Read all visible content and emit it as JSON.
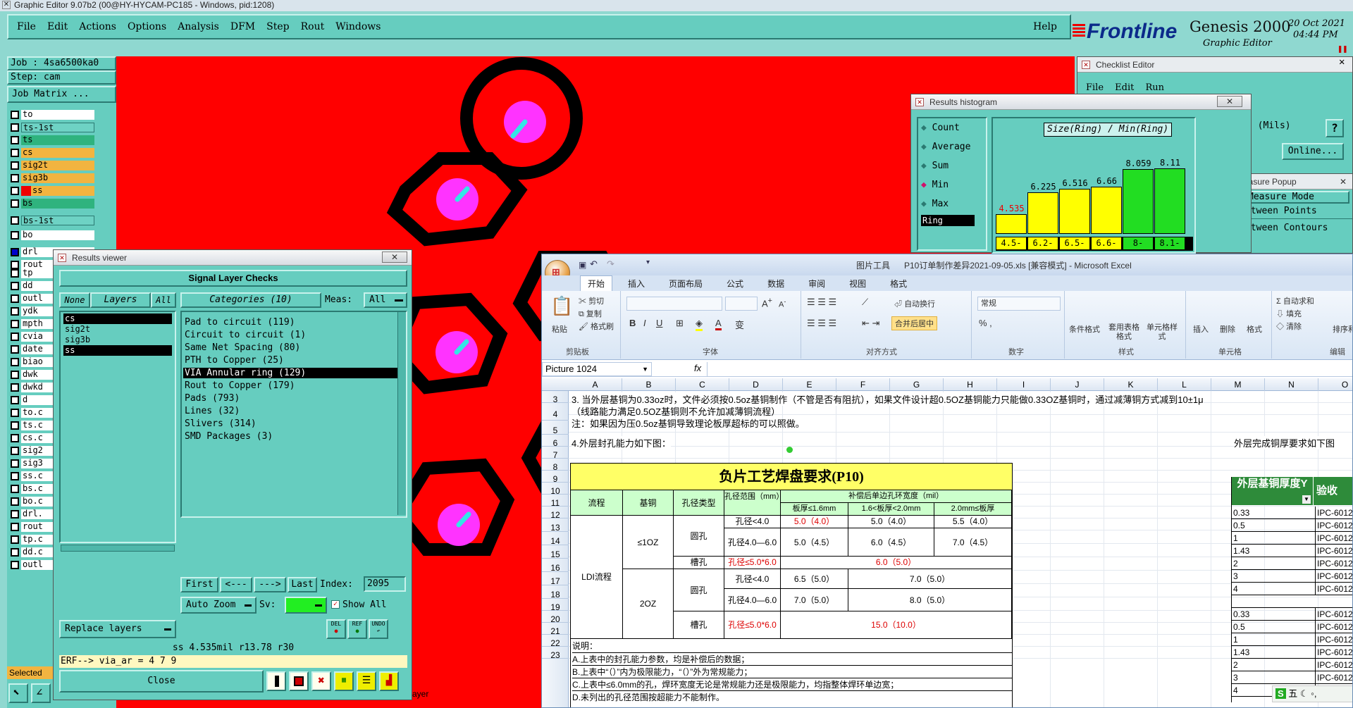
{
  "window_title": "Graphic Editor 9.07b2 (00@HY-HYCAM-PC185 - Windows, pid:1208)",
  "menu": [
    "File",
    "Edit",
    "Actions",
    "Options",
    "Analysis",
    "DFM",
    "Step",
    "Rout",
    "Windows"
  ],
  "help": "Help",
  "brand": {
    "name": "Frontline",
    "product": "Genesis 2000",
    "subtitle": "Graphic Editor",
    "date": "20 Oct 2021",
    "time": "04:44 PM"
  },
  "job": {
    "job_label": "Job : 4sa6500ka0",
    "step_label": "Step: cam",
    "matrix_btn": "Job Matrix ..."
  },
  "layers": [
    {
      "name": "to",
      "bg": "#ffffff"
    },
    {
      "name": "ts-1st",
      "bg": "#6ed2c4"
    },
    {
      "name": "ts",
      "bg": "#2fb37e"
    },
    {
      "name": "cs",
      "bg": "#f2b440"
    },
    {
      "name": "sig2t",
      "bg": "#f2b440"
    },
    {
      "name": "sig3b",
      "bg": "#f2b440"
    },
    {
      "name": "ss",
      "bg": "#f2b440"
    },
    {
      "name": "bs",
      "bg": "#2fb37e"
    },
    {
      "name": "bs-1st",
      "bg": "#6ed2c4"
    },
    {
      "name": "bo",
      "bg": "#ffffff"
    },
    {
      "name": "drl",
      "bg": "#ffffff"
    },
    {
      "name": "rout",
      "bg": "#ffffff"
    }
  ],
  "layers_lower": [
    "tp",
    "dd",
    "outl",
    "ydk",
    "mpth",
    "cvia",
    "date",
    "biao",
    "dwk",
    "dwkd",
    "d",
    "to.c",
    "ts.c",
    "cs.c",
    "sig2",
    "sig3",
    "ss.c",
    "bs.c",
    "bo.c",
    "drl.",
    "rout",
    "tp.c",
    "dd.c",
    "outl"
  ],
  "selected_label": "Selected",
  "results": {
    "title": "Results viewer",
    "header": "Signal Layer Checks",
    "none": "None",
    "layers": "Layers",
    "all": "All",
    "categories": "Categories (10)",
    "meas": "Meas:",
    "meas_value": "All",
    "layer_list": [
      "cs",
      "sig2t",
      "sig3b",
      "ss"
    ],
    "category_list": [
      "Pad to circuit (119)",
      "Circuit to circuit (1)",
      "Same Net Spacing (80)",
      "PTH to Copper (25)",
      "VIA Annular ring (129)",
      "Rout to Copper (179)",
      "Pads (793)",
      "Lines (32)",
      "Slivers (314)",
      "SMD Packages (3)"
    ],
    "first": "First",
    "prev": "<---",
    "next": "--->",
    "last": "Last",
    "index_label": "Index:",
    "index_value": "2095",
    "auto_zoom": "Auto Zoom",
    "sv": "Sv:",
    "show_all": "Show All",
    "replace_layers": "Replace layers",
    "status": "ss 4.535mil   r13.78   r30",
    "erf": "ERF--> via_ar = 4 7 9",
    "close": "Close",
    "del": "DEL",
    "ref": "REF",
    "undo": "UNDO"
  },
  "histogram": {
    "title": "Results histogram",
    "heading": "Size(Ring) / Min(Ring)",
    "options": [
      "Count",
      "Average",
      "Sum",
      "Min",
      "Max"
    ],
    "selected": "Min",
    "ring": "Ring",
    "values": [
      4.535,
      6.225,
      6.516,
      6.66,
      8.059,
      8.11
    ],
    "value_labels": [
      "4.535",
      "6.225",
      "6.516",
      "6.66",
      "8.059",
      "8.11"
    ],
    "bin_labels": [
      "4.5-",
      "6.2-",
      "6.5-",
      "6.6-",
      "8-",
      "8.1-"
    ],
    "colors": [
      "#ffff00",
      "#ffff00",
      "#ffff00",
      "#ffff00",
      "#22dd22",
      "#22dd22"
    ]
  },
  "checklist": {
    "title": "Checklist Editor",
    "menu": [
      "File",
      "Edit",
      "Run"
    ],
    "mils": "d (Mils)",
    "online": "Online..."
  },
  "measure": {
    "title": "easure Popup",
    "mode": "Measure Mode",
    "between_points": "etween Points",
    "between_contours": "etween Contours"
  },
  "bottom_tab": "ayer",
  "excel": {
    "qat_title": "图片工具",
    "title": "P10订单制作差异2021-09-05.xls [兼容模式] - Microsoft Excel",
    "tabs": [
      "开始",
      "插入",
      "页面布局",
      "公式",
      "数据",
      "审阅",
      "视图",
      "格式"
    ],
    "groups": [
      "剪贴板",
      "字体",
      "对齐方式",
      "数字",
      "样式",
      "单元格",
      "编辑"
    ],
    "clip": [
      "剪切",
      "复制",
      "格式刷",
      "粘贴"
    ],
    "wrap": "自动换行",
    "merge": "合并后居中",
    "numfmt": "常规",
    "styles": [
      "条件格式",
      "套用表格格式",
      "单元格样式"
    ],
    "cells": [
      "插入",
      "删除",
      "格式"
    ],
    "edit": [
      "自动求和",
      "填充",
      "清除",
      "排序和筛选"
    ],
    "name_box": "Picture 1024",
    "fx": "fx",
    "cols": [
      "A",
      "B",
      "C",
      "D",
      "E",
      "F",
      "G",
      "H",
      "I",
      "J",
      "K",
      "L",
      "M",
      "N",
      "O"
    ],
    "rows": [
      "3",
      "4",
      "5",
      "6",
      "7",
      "8",
      "9",
      "10",
      "11",
      "12",
      "13",
      "14",
      "15",
      "16",
      "17",
      "18",
      "19",
      "20",
      "21",
      "22",
      "23"
    ],
    "text": {
      "r3": "3. 当外层基铜为0.33oz时，文件必须按0.5oz基铜制作（不管是否有阻抗），如果文件设计超0.5OZ基铜能力只能做0.33OZ基铜时，通过减薄铜方式减到10±1μ",
      "r3b": "（线路能力满足0.5OZ基铜则不允许加减薄铜流程）",
      "r4": "注：如果因为压0.5oz基铜导致理论板厚超标的可以照做。",
      "r5": "4.外层封孔能力如下图：",
      "r5r": "外层完成铜厚要求如下图"
    },
    "table": {
      "title": "负片工艺焊盘要求(P10)",
      "h_process": "流程",
      "h_copper": "基铜",
      "h_type": "孔径类型",
      "h_range": "孔径范围（mm）",
      "h_comp": "补偿后单边孔环宽度（mil）",
      "h_t1": "板厚≤1.6mm",
      "h_t2": "1.6<板厚<2.0mm",
      "h_t3": "2.0mm≤板厚",
      "ldi": "LDI流程",
      "oz1": "≤1OZ",
      "oz2": "2OZ",
      "round": "圆孔",
      "slot": "槽孔",
      "r10": [
        "孔径<4.0",
        "5.0（4.0）",
        "5.0（4.0）",
        "5.5（4.0）"
      ],
      "r11": [
        "孔径4.0—6.0",
        "5.0（4.5）",
        "6.0（4.5）",
        "7.0（4.5）"
      ],
      "r12": [
        "孔径≤5.0*6.0",
        "6.0（5.0）"
      ],
      "r14": [
        "孔径<4.0",
        "6.5（5.0）",
        "7.0（5.0）"
      ],
      "r15": [
        "孔径4.0—6.0",
        "7.0（5.0）",
        "8.0（5.0）"
      ],
      "r17": [
        "孔径≤5.0*6.0",
        "15.0（10.0）"
      ],
      "notes": [
        "说明：",
        "A.上表中的封孔能力参数，均是补偿后的数据；",
        "B.上表中“（）”内为极限能力，“（）”外为常规能力；",
        "C.上表中≤6.0mm的孔，焊环宽度无论是常规能力还是极限能力，均指整体焊环单边宽；",
        "D.未列出的孔径范围按超能力不能制作。"
      ]
    },
    "side": {
      "h1": "外层基铜厚度Y",
      "h2": "验收",
      "vals": [
        "0.33",
        "0.5",
        "1",
        "1.43",
        "2",
        "3",
        "4",
        "",
        "0.33",
        "0.5",
        "1",
        "1.43",
        "2",
        "3",
        "4"
      ],
      "ipc": "IPC-6012"
    },
    "ime": "五"
  }
}
